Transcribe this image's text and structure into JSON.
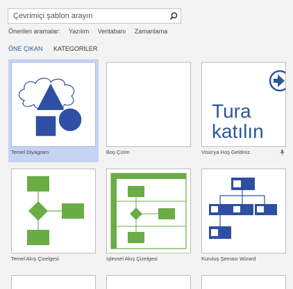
{
  "search": {
    "placeholder": "Çevrimiçi şablon arayın"
  },
  "suggested": {
    "label": "Önerilen aramalar:",
    "items": [
      "Yazılım",
      "Veritabanı",
      "Zamanlama"
    ]
  },
  "tabs": [
    "ÖNE ÇIKAN",
    "KATEGORİLER"
  ],
  "templates": [
    {
      "label": "Temel Diyagram",
      "selected": true
    },
    {
      "label": "Boş Çizim"
    },
    {
      "label": "Visio'ya Hoş Geldiniz",
      "thumb_text": [
        "Tura",
        "katılın"
      ]
    },
    {
      "label": "Temel Akış Çizelgesi"
    },
    {
      "label": "İşlevsel Akış Çizelgesi"
    },
    {
      "label": "Kuruluş Şeması Wizard"
    }
  ],
  "colors": {
    "shape_blue": "#2e4fa3",
    "flow_green": "#6aac46",
    "accent": "#1f5fa8",
    "selected": "#c7d3f3"
  }
}
